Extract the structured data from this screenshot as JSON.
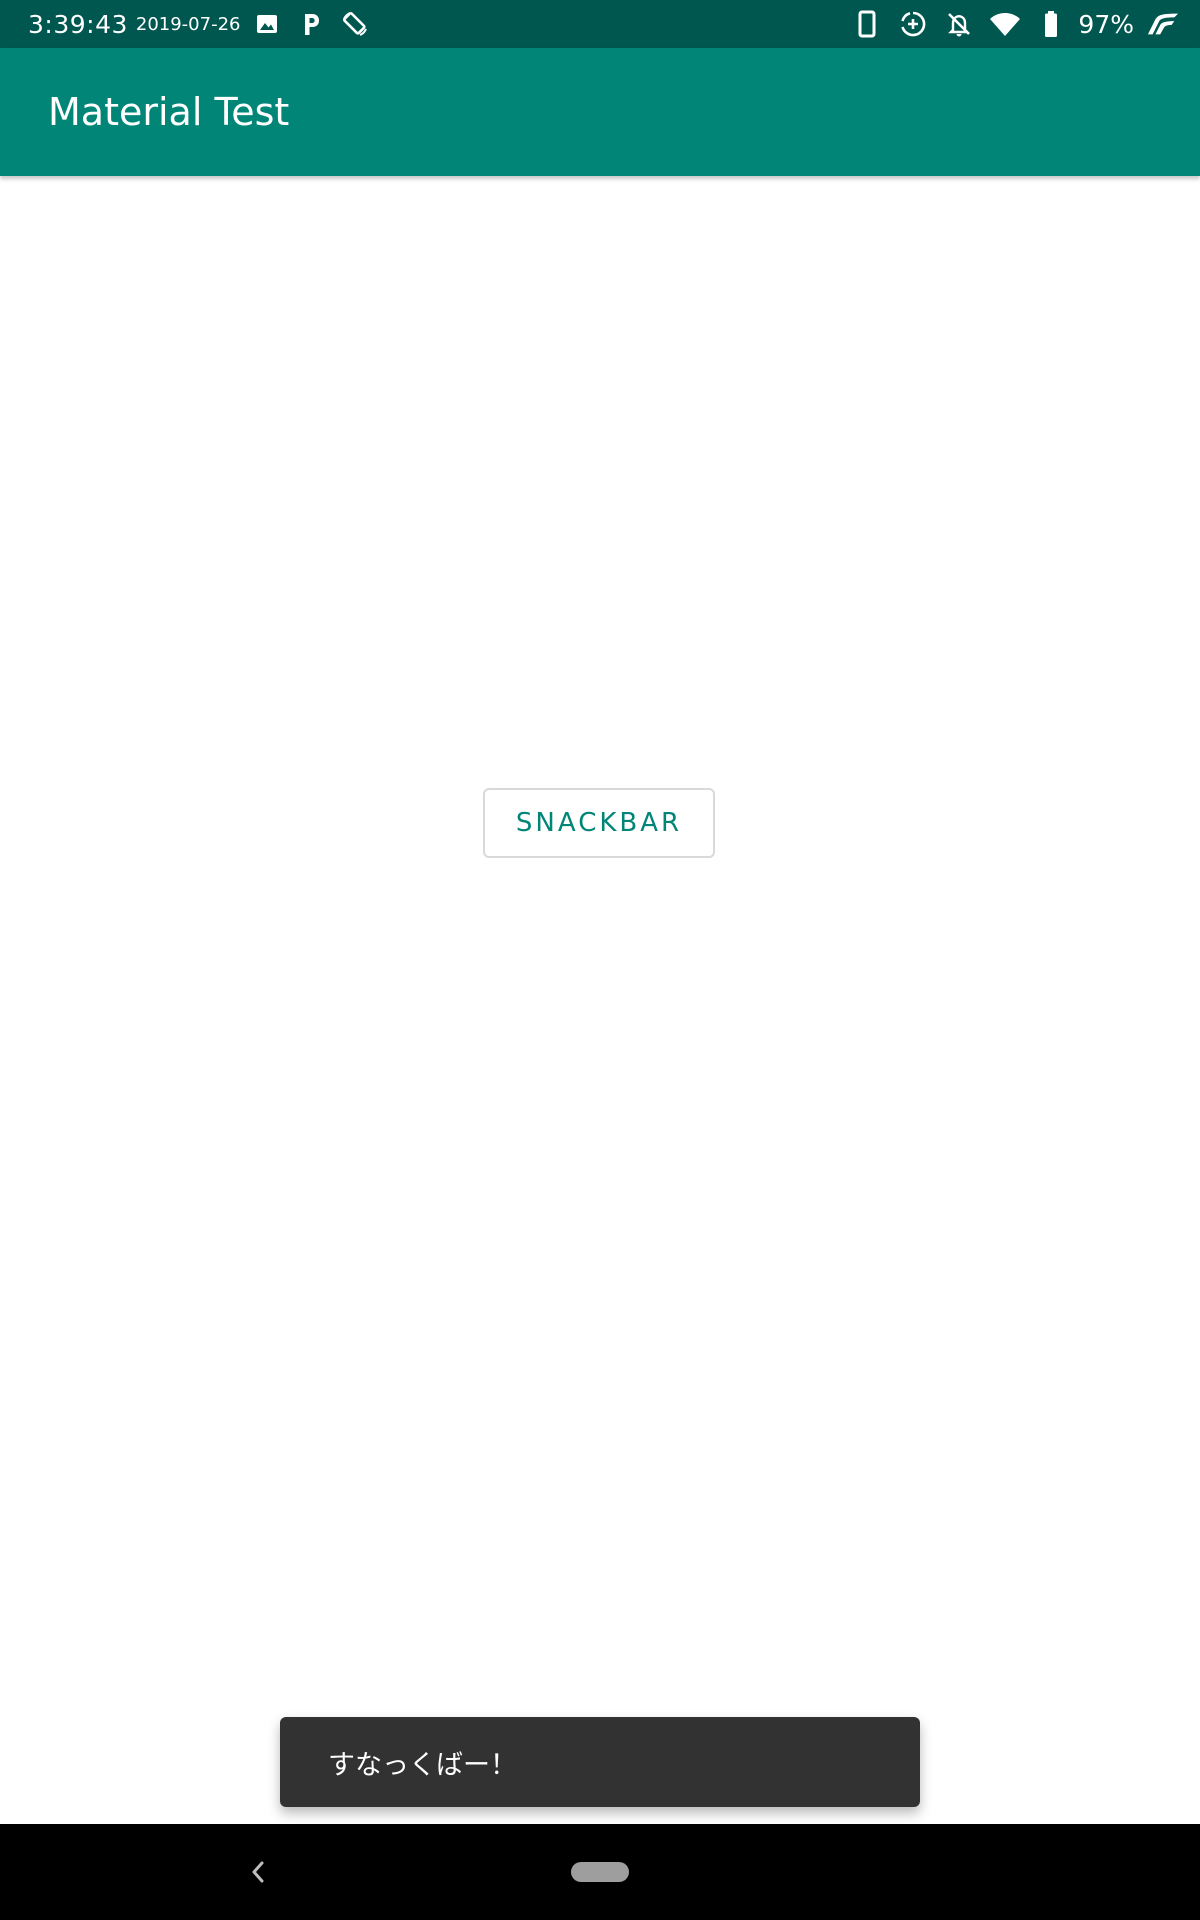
{
  "status_bar": {
    "time": "3:39:43",
    "date": "2019-07-26",
    "battery_percent": "97%",
    "left_icons": [
      "image-icon",
      "parking-icon",
      "screen-rotation-icon"
    ],
    "right_icons": [
      "phone-device-icon",
      "data-saver-icon",
      "notifications-off-icon",
      "wifi-icon",
      "battery-icon",
      "signal-icon"
    ],
    "background_color": "#00574f"
  },
  "app_bar": {
    "title": "Material Test",
    "background_color": "#008577"
  },
  "main": {
    "button_label": "SNACKBAR",
    "accent_color": "#008577"
  },
  "snackbar": {
    "message": "すなっくばー！",
    "background_color": "#323232"
  },
  "nav_bar": {
    "icons": [
      "back-icon",
      "home-pill-icon"
    ]
  }
}
